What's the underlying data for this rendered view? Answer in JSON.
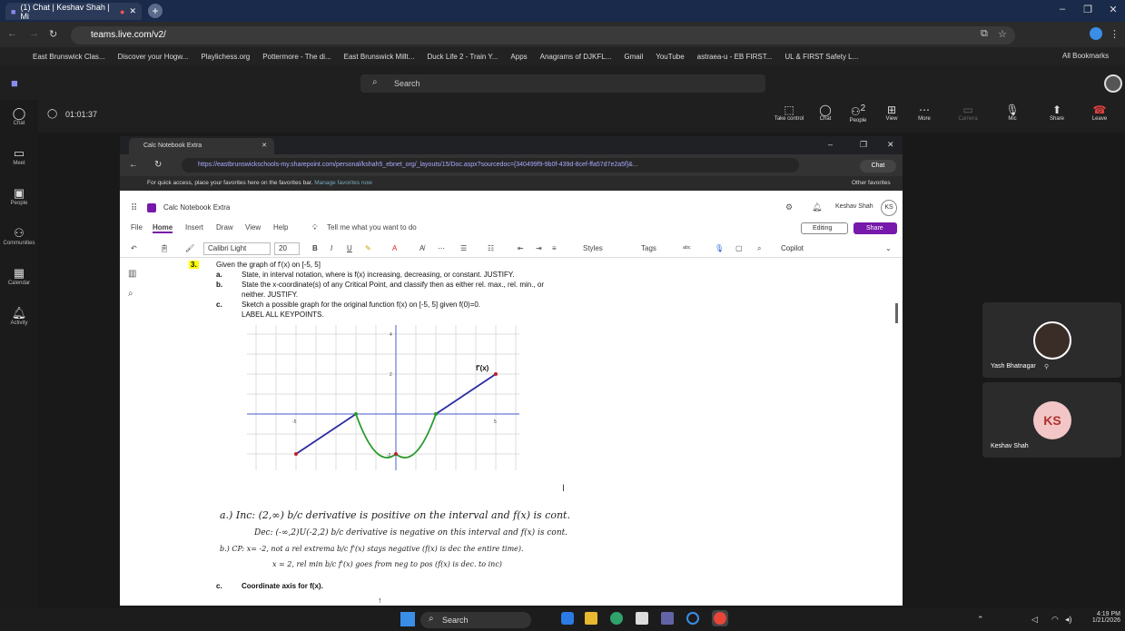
{
  "browser": {
    "tab_title": "(1) Chat | Keshav Shah | Mi",
    "url": "teams.live.com/v2/",
    "bookmarks": [
      "East Brunswick Clas...",
      "Discover your Hogw...",
      "Playlichess.org",
      "Pottermore - The di...",
      "East Brunswick Millt...",
      "Duck Life 2 - Train Y...",
      "Apps",
      "Anagrams of DJKFL...",
      "Gmail",
      "YouTube",
      "astraea-u - EB FIRST...",
      "UL & FIRST Safety L..."
    ],
    "all_bookmarks": "All Bookmarks"
  },
  "teams": {
    "search": "Search",
    "timer": "01:01:37",
    "rail": [
      {
        "label": "Chat",
        "icon": "chat-icon"
      },
      {
        "label": "Meet",
        "icon": "video-icon"
      },
      {
        "label": "People",
        "icon": "people-icon"
      },
      {
        "label": "Communities",
        "icon": "communities-icon"
      },
      {
        "label": "Calendar",
        "icon": "calendar-icon"
      },
      {
        "label": "Activity",
        "icon": "bell-icon"
      }
    ],
    "meeting_buttons": [
      {
        "label": "Take control"
      },
      {
        "label": "Chat"
      },
      {
        "label": "People",
        "badge": "2"
      },
      {
        "label": "View"
      },
      {
        "label": "More"
      },
      {
        "label": "Camera"
      },
      {
        "label": "Mic"
      },
      {
        "label": "Share"
      },
      {
        "label": "Leave"
      }
    ]
  },
  "edge": {
    "tab_title": "Calc Notebook Extra",
    "url": "https://eastbrunswickschools-my.sharepoint.com/personal/kshah5_ebnet_org/_layouts/15/Doc.aspx?sourcedoc={340499f9-9b0f-439d-8cef-ffa57d7e2a5f}&...",
    "chat": "Chat",
    "fav_msg": "For quick access, place your favorites here on the favorites bar.",
    "fav_link": "Manage favorites now",
    "other_fav": "Other favorites"
  },
  "onenote": {
    "app_title": "Calc Notebook Extra",
    "user": "Keshav Shah",
    "initials": "KS",
    "tabs": [
      "File",
      "Home",
      "Insert",
      "Draw",
      "View",
      "Help"
    ],
    "tell": "Tell me what you want to do",
    "editing": "Editing",
    "share": "Share",
    "font": "Calibri Light",
    "size": "20",
    "styles": "Styles",
    "tags": "Tags",
    "copilot": "Copilot"
  },
  "problem": {
    "num": "3.",
    "stem": "Given the graph of f'(x) on [-5, 5]",
    "parts": [
      {
        "l": "a.",
        "t": "State, in interval notation, where is f(x) increasing, decreasing, or constant. JUSTIFY."
      },
      {
        "l": "b.",
        "t": "State the x-coordinate(s) of any Critical Point, and classify then as either rel. max., rel. min., or"
      },
      {
        "l": "",
        "t": "neither. JUSTIFY."
      },
      {
        "l": "c.",
        "t": "Sketch a possible graph for the original function f(x) on [-5, 5] given f(0)=0."
      },
      {
        "l": "",
        "t": "LABEL ALL KEYPOINTS."
      }
    ],
    "graph_label": "f'(x)",
    "ticks": {
      "x_neg": "-5",
      "x_pos": "5",
      "y_top": "4",
      "y_mid": "2",
      "y_low": "-2"
    },
    "handwriting": [
      "a.) Inc: (2,∞) b/c derivative is positive on the interval and f(x) is cont.",
      "Dec: (-∞,2)U(-2,2) b/c derivative is negative on this interval and f(x) is cont.",
      "b.) CP:  x= -2, not a rel extrema b/c f'(x) stays negative (f(x) is dec the entire time).",
      "x = 2, rel min b/c f'(x) goes from neg to pos (f(x) is dec. to inc)"
    ],
    "part_c": {
      "l": "c.",
      "t": "Coordinate axis for f(x)."
    }
  },
  "tiles": [
    {
      "name": "Yash Bhatnagar"
    },
    {
      "name": "Keshav Shah",
      "initials": "KS"
    }
  ],
  "taskbar": {
    "search": "Search",
    "time": "4:19 PM",
    "date": "1/21/2026"
  },
  "colors": {
    "accent": "#6264a7",
    "line": "#2a2aa0",
    "curve": "#2a9a2a",
    "leave": "#e04040"
  }
}
